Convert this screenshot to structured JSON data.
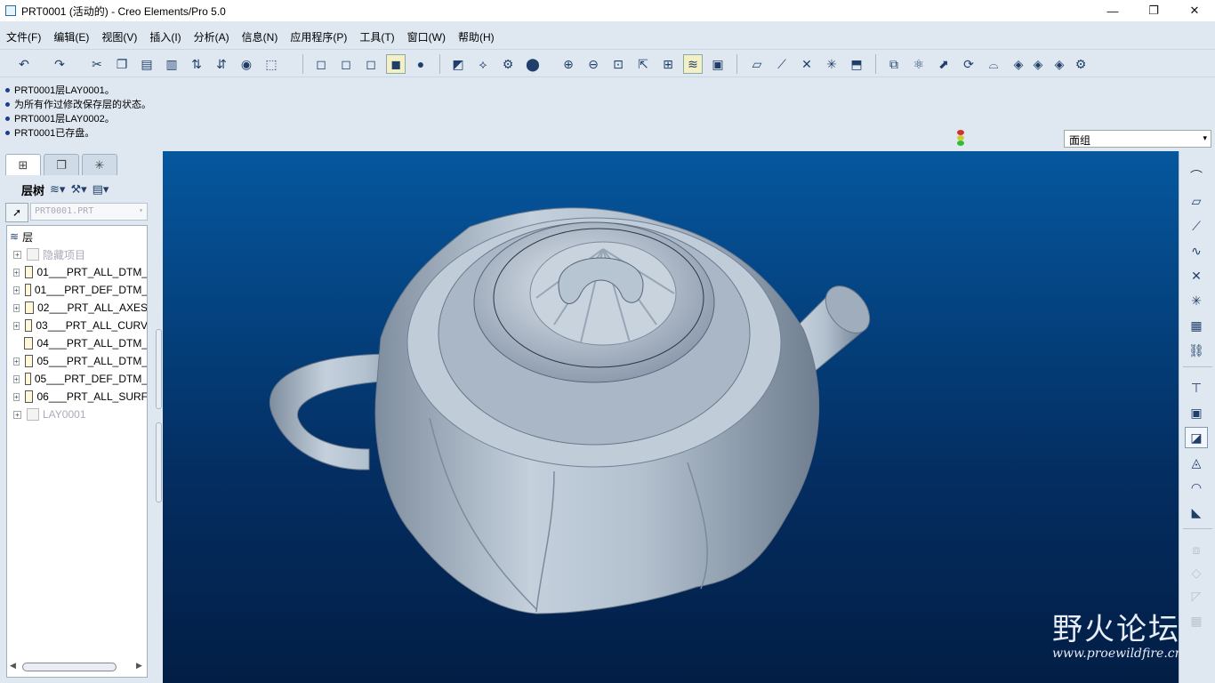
{
  "window": {
    "title": "PRT0001 (活动的) - Creo Elements/Pro 5.0",
    "controls": [
      "—",
      "❐",
      "✕"
    ]
  },
  "menu": [
    "文件(F)",
    "编辑(E)",
    "视图(V)",
    "插入(I)",
    "分析(A)",
    "信息(N)",
    "应用程序(P)",
    "工具(T)",
    "窗口(W)",
    "帮助(H)"
  ],
  "messages": [
    "PRT0001层LAY0001。",
    "为所有作过修改保存层的状态。",
    "PRT0001层LAY0002。",
    "PRT0001已存盘。"
  ],
  "filter": {
    "value": "面组",
    "arrow": "▾"
  },
  "panel": {
    "tab_icons": [
      "tree-icon",
      "layers-icon",
      "favorites-icon"
    ],
    "layer_title": "层树",
    "model_value": "PRT0001.PRT",
    "tree_root": "层",
    "tree_items": [
      {
        "label": "隐藏项目",
        "dim": true,
        "expand": true
      },
      {
        "label": "01___PRT_ALL_DTM_",
        "dim": false,
        "expand": true
      },
      {
        "label": "01___PRT_DEF_DTM_",
        "dim": false,
        "expand": true
      },
      {
        "label": "02___PRT_ALL_AXES",
        "dim": false,
        "expand": true
      },
      {
        "label": "03___PRT_ALL_CURV",
        "dim": false,
        "expand": true
      },
      {
        "label": "04___PRT_ALL_DTM_",
        "dim": false,
        "expand": false
      },
      {
        "label": "05___PRT_ALL_DTM_",
        "dim": false,
        "expand": true
      },
      {
        "label": "05___PRT_DEF_DTM_",
        "dim": false,
        "expand": true
      },
      {
        "label": "06___PRT_ALL_SURF",
        "dim": false,
        "expand": true
      },
      {
        "label": "LAY0001",
        "dim": true,
        "expand": true
      }
    ],
    "expand_glyph": "+"
  },
  "watermark": {
    "title": "野火论坛",
    "url": "www.proewildfire.cn"
  },
  "colors": {
    "viewport_top": "#05579e",
    "viewport_bottom": "#021e45",
    "model": "#aebccb"
  }
}
